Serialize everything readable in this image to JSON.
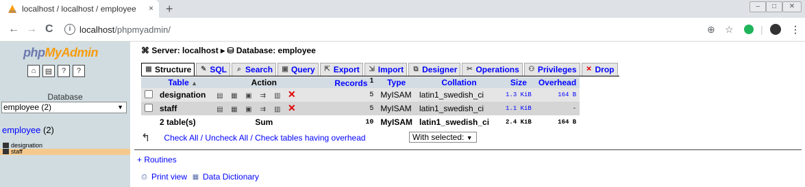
{
  "browser": {
    "tab_title": "localhost / localhost / employee",
    "tab_close": "×",
    "new_tab": "+",
    "url_host": "localhost",
    "url_path": "/phpmyadmin/",
    "info_icon": "i",
    "back": "←",
    "forward": "→",
    "reload": "C",
    "zoom": "⊕",
    "star": "☆",
    "menu": "⋮",
    "win_min": "–",
    "win_max": "□",
    "win_close": "✕"
  },
  "left": {
    "logo_php": "php",
    "logo_my": "My",
    "logo_admin": "Admin",
    "database_label": "Database",
    "database_select": "employee (2)",
    "select_arrow": "▼",
    "db_name": "employee",
    "db_count": " (2)",
    "tables": [
      {
        "name": "designation"
      },
      {
        "name": "staff"
      }
    ]
  },
  "main": {
    "crumb_server": "Server: localhost",
    "crumb_sep": "▸",
    "crumb_db": "Database: employee",
    "tabs": [
      {
        "label": "Structure",
        "icon": "▦"
      },
      {
        "label": "SQL",
        "icon": "✎"
      },
      {
        "label": "Search",
        "icon": "⌕"
      },
      {
        "label": "Query",
        "icon": "▣"
      },
      {
        "label": "Export",
        "icon": "⇱"
      },
      {
        "label": "Import",
        "icon": "⇲"
      },
      {
        "label": "Designer",
        "icon": "⧉"
      },
      {
        "label": "Operations",
        "icon": "✂"
      },
      {
        "label": "Privileges",
        "icon": "⚇"
      },
      {
        "label": "Drop",
        "icon": "✕"
      }
    ],
    "headers": {
      "table": "Table",
      "sort_arrow": "▲",
      "action": "Action",
      "records": "Records",
      "records_sup": "1",
      "type": "Type",
      "collation": "Collation",
      "size": "Size",
      "overhead": "Overhead"
    },
    "rows": [
      {
        "table": "designation",
        "records": "5",
        "type": "MyISAM",
        "collation": "latin1_swedish_ci",
        "size": "1.3 KiB",
        "overhead": "164 B"
      },
      {
        "table": "staff",
        "records": "5",
        "type": "MyISAM",
        "collation": "latin1_swedish_ci",
        "size": "1.1 KiB",
        "overhead": "-"
      }
    ],
    "summary": {
      "table": "2 table(s)",
      "action": "Sum",
      "records": "10",
      "type": "MyISAM",
      "collation": "latin1_swedish_ci",
      "size": "2.4 KiB",
      "overhead": "164 B"
    },
    "check_all": "Check All / Uncheck All / Check tables having overhead",
    "with_selected": "With selected:",
    "with_selected_arrow": "▼",
    "routines": "+ Routines",
    "print_view": "Print view",
    "data_dictionary": "Data Dictionary"
  },
  "colors": {
    "left_bg": "#d0dce0",
    "header_bg": "#d3dce3",
    "link": "#0000ff",
    "highlight": "#f5c98e"
  }
}
